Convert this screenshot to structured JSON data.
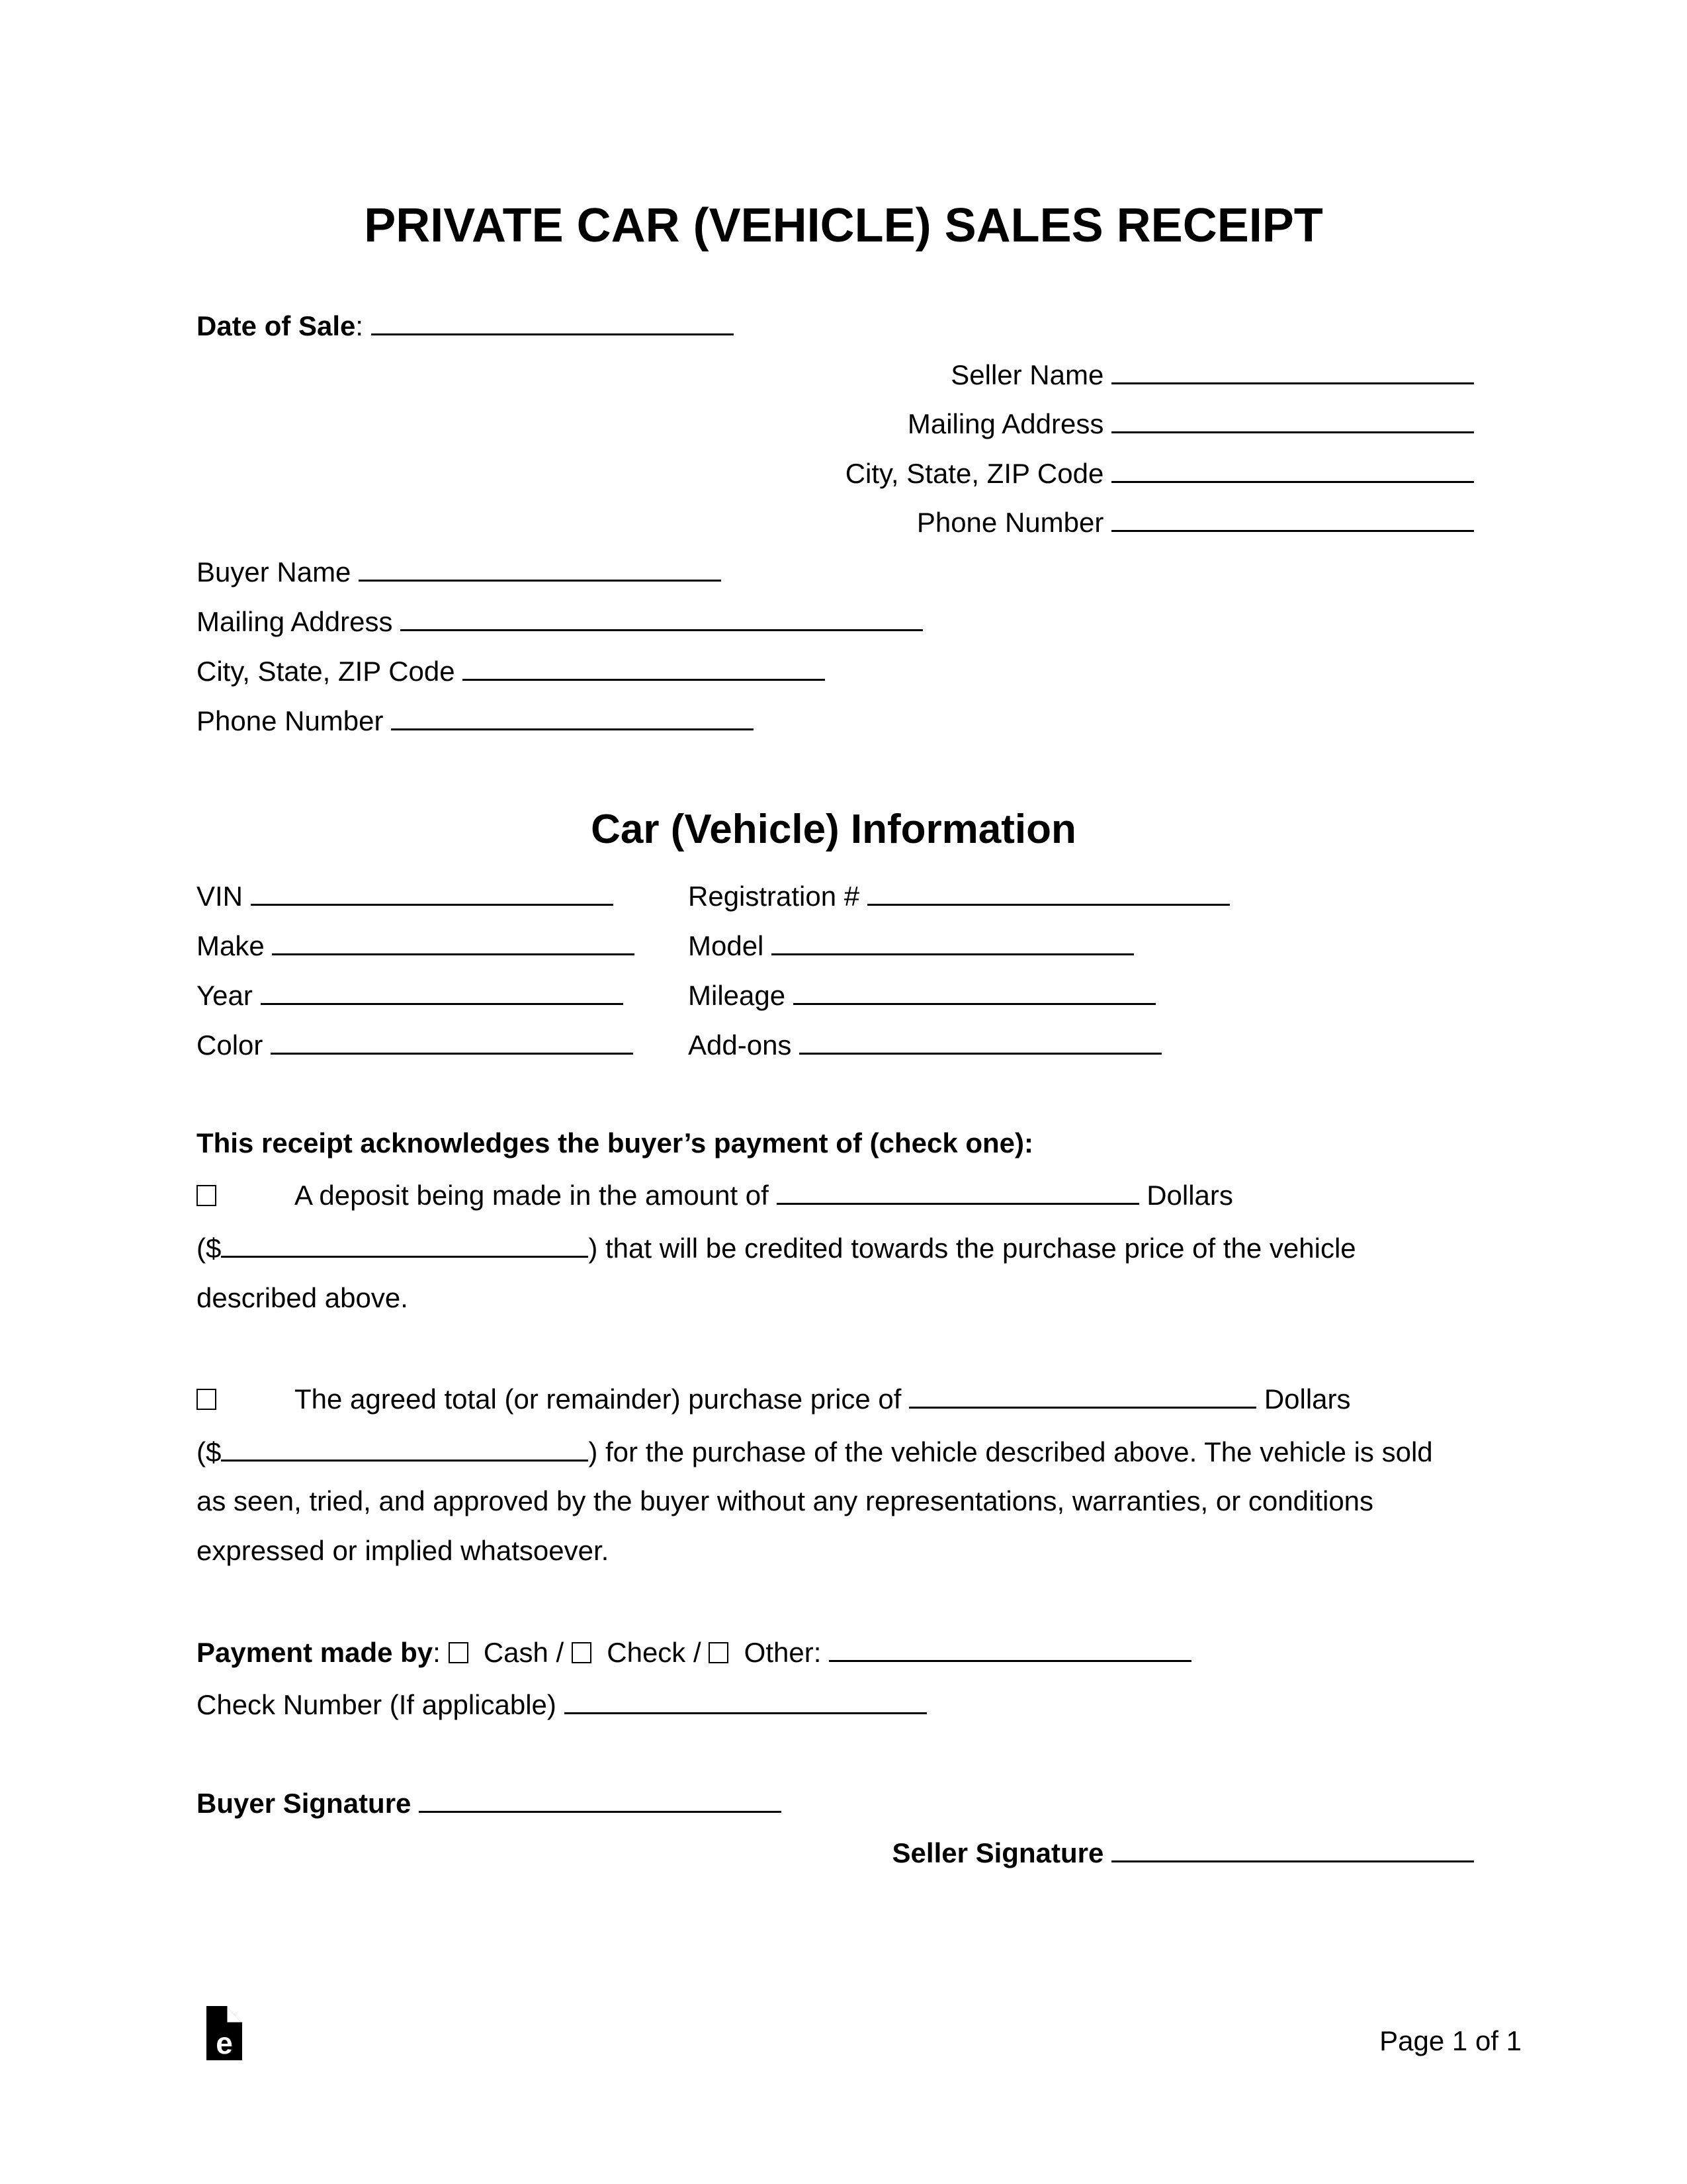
{
  "document": {
    "title": "PRIVATE CAR (VEHICLE) SALES RECEIPT",
    "date_of_sale_label": "Date of Sale",
    "date_of_sale_colon": ":",
    "seller": {
      "name_label": "Seller Name",
      "mailing_address_label": "Mailing Address",
      "city_state_zip_label": "City, State, ZIP Code",
      "phone_label": "Phone Number"
    },
    "buyer": {
      "name_label": "Buyer Name",
      "mailing_address_label": "Mailing Address",
      "city_state_zip_label": "City, State, ZIP Code",
      "phone_label": "Phone Number"
    },
    "vehicle_section_title": "Car (Vehicle) Information",
    "vehicle_fields_left": [
      "VIN",
      "Make",
      "Year",
      "Color"
    ],
    "vehicle_fields_right": [
      "Registration #",
      "Model",
      "Mileage",
      "Add-ons"
    ],
    "payment_heading": "This receipt acknowledges the buyer’s payment of (check one):",
    "option_deposit": {
      "line1_text": "A deposit being made in the amount of",
      "dollars": "Dollars",
      "paren_open": "($",
      "line2_text": ") that will be credited towards the purchase price of the vehicle",
      "line3_text": "described above."
    },
    "option_total": {
      "line1_text": "The agreed total (or remainder) purchase price of",
      "dollars": "Dollars",
      "paren_open": "($",
      "line2_text": ") for the purchase of the vehicle described above. The vehicle is sold",
      "line3_text": "as seen, tried, and approved by the buyer without any representations, warranties, or conditions",
      "line4_text": "expressed or implied whatsoever."
    },
    "payment_method": {
      "label": "Payment made by",
      "colon": ":",
      "options": [
        "Cash /",
        "Check /",
        "Other:"
      ]
    },
    "check_number_label": "Check Number (If applicable)",
    "buyer_signature_label": "Buyer Signature",
    "seller_signature_label": "Seller Signature",
    "footer": {
      "logo_icon": "eforms-logo-icon",
      "page_label": "Page 1 of 1"
    }
  }
}
